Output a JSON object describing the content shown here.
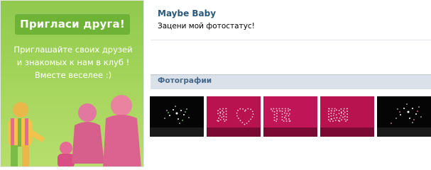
{
  "banner": {
    "title": "Пригласи друга!",
    "lines": [
      "Приглашайте своих друзей",
      "и знакомых к нам в клуб !",
      "Вместе веселее :)"
    ]
  },
  "profile": {
    "name": "Maybe Baby",
    "status": "Зацени мой фотостатус!"
  },
  "photos_section": {
    "title": "Фотографии",
    "photos": [
      {
        "label": "",
        "icon": "firework"
      },
      {
        "label": "Я",
        "icon": "heart"
      },
      {
        "label": "ТЕ",
        "icon": ""
      },
      {
        "label": "БЯ",
        "icon": ""
      },
      {
        "label": "",
        "icon": "firework"
      }
    ]
  },
  "colors": {
    "banner_green": "#a3d45a",
    "link_blue": "#2b587a",
    "header_bg": "#dae1e8",
    "photo_pink": "#d0306a"
  }
}
